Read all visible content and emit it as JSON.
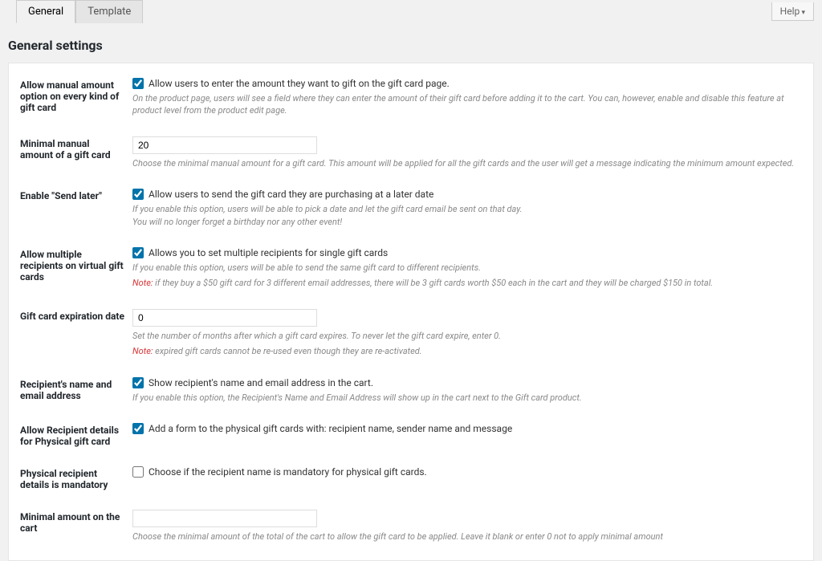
{
  "header": {
    "tabs": [
      {
        "label": "General",
        "active": true
      },
      {
        "label": "Template",
        "active": false
      }
    ],
    "help": "Help"
  },
  "section_title": "General settings",
  "rows": {
    "manual_amount": {
      "label": "Allow manual amount option on every kind of gift card",
      "check_label": "Allow users to enter the amount they want to gift on the gift card page.",
      "help": "On the product page, users will see a field where they can enter the amount of their gift card before adding it to the cart. You can, however, enable and disable this feature at product level from the product edit page."
    },
    "min_manual": {
      "label": "Minimal manual amount of a gift card",
      "value": "20",
      "help": "Choose the minimal manual amount for a gift card. This amount will be applied for all the gift cards and the user will get a message indicating the minimum amount expected."
    },
    "send_later": {
      "label": "Enable \"Send later\"",
      "check_label": "Allow users to send the gift card they are purchasing at a later date",
      "help": "If you enable this option, users will be able to pick a date and let the gift card email be sent on that day.\nYou will no longer forget a birthday nor any other event!"
    },
    "multi_recip": {
      "label": "Allow multiple recipients on virtual gift cards",
      "check_label": "Allows you to set multiple recipients for single gift cards",
      "help": "If you enable this option, users will be able to send the same gift card to different recipients.",
      "note_prefix": "Note:",
      "note": " if they buy a $50 gift card for 3 different email addresses, there will be 3 gift cards worth $50 each in the cart and they will be charged $150 in total."
    },
    "expiration": {
      "label": "Gift card expiration date",
      "value": "0",
      "help": "Set the number of months after which a gift card expires. To never let the gift card expire, enter 0.",
      "note_prefix": "Note:",
      "note": " expired gift cards cannot be re-used even though they are re-activated."
    },
    "recip_name": {
      "label": "Recipient's name and email address",
      "check_label": "Show recipient's name and email address in the cart.",
      "help": "If you enable this option, the Recipient's Name and Email Address will show up in the cart next to the Gift card product."
    },
    "physical_details": {
      "label": "Allow Recipient details for Physical gift card",
      "check_label": "Add a form to the physical gift cards with: recipient name, sender name and message"
    },
    "physical_mandatory": {
      "label": "Physical recipient details is mandatory",
      "check_label": "Choose if the recipient name is mandatory for physical gift cards."
    },
    "min_cart": {
      "label": "Minimal amount on the cart",
      "value": "",
      "help": "Choose the minimal amount of the total of the cart to allow the gift card to be applied. Leave it blank or enter 0 not to apply minimal amount"
    }
  }
}
